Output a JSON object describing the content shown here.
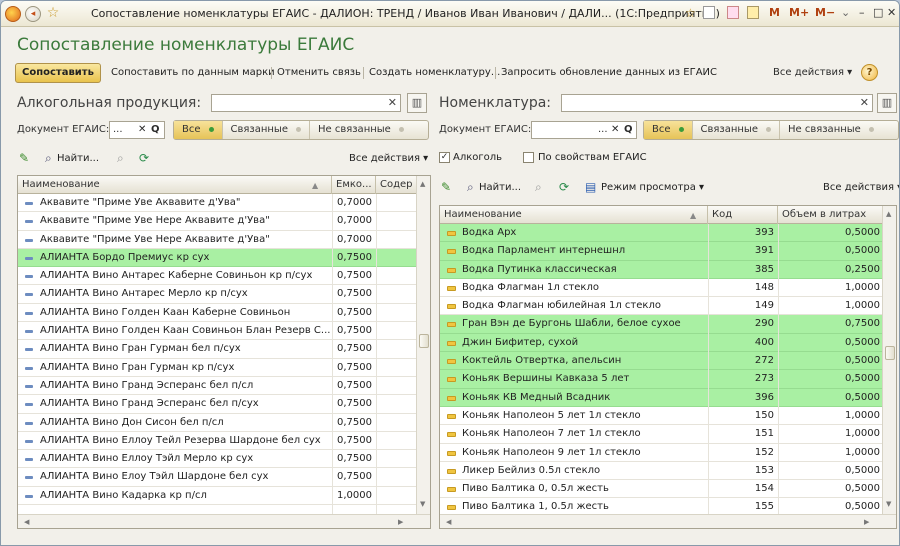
{
  "window": {
    "title": "Сопоставление номенклатуры ЕГАИС - ДАЛИОН: ТРЕНД / Иванов Иван Иванович / ДАЛИ...  (1С:Предприятие)"
  },
  "form": {
    "title": "Сопоставление номенклатуры ЕГАИС"
  },
  "cmdbar": {
    "match_label": "Сопоставить",
    "commands": [
      "Сопоставить по данным марки",
      "Отменить связь",
      "Создать номенклатуру...",
      "Запросить обновление данных из ЕГАИС"
    ],
    "all_actions": "Все действия ▾",
    "help": "?"
  },
  "left": {
    "label": "Алкогольная продукция:",
    "search_value": "",
    "doc_label": "Документ ЕГАИС:",
    "doc_value": "...",
    "filters": [
      "Все",
      "Связанные",
      "Не связанные"
    ],
    "toolbar_find": "Найти...",
    "all_actions": "Все действия ▾",
    "columns": [
      "Наименование",
      "Емко...",
      "Содер"
    ],
    "rows": [
      {
        "name": "Аквавите \"Приме Уве Аквавите д'Ува\"",
        "cap": "0,7000",
        "hl": false
      },
      {
        "name": "Аквавите \"Приме Уве Нере Аквавите д'Ува\"",
        "cap": "0,7000",
        "hl": false
      },
      {
        "name": "Аквавите \"Приме Уве Нере Аквавите д'Ува\"",
        "cap": "0,7000",
        "hl": false
      },
      {
        "name": "АЛИАНТА Бордо Премиус кр сух",
        "cap": "0,7500",
        "hl": true
      },
      {
        "name": "АЛИАНТА Вино Антарес Каберне Совиньон кр п/сух",
        "cap": "0,7500",
        "hl": false
      },
      {
        "name": "АЛИАНТА Вино Антарес Мерло кр п/сух",
        "cap": "0,7500",
        "hl": false
      },
      {
        "name": "АЛИАНТА Вино Голден Каан Каберне Совиньон",
        "cap": "0,7500",
        "hl": false
      },
      {
        "name": "АЛИАНТА Вино Голден Каан Совиньон Блан Резерв С...",
        "cap": "0,7500",
        "hl": false
      },
      {
        "name": "АЛИАНТА Вино Гран Гурман бел п/сух",
        "cap": "0,7500",
        "hl": false
      },
      {
        "name": "АЛИАНТА Вино Гран Гурман кр п/сух",
        "cap": "0,7500",
        "hl": false
      },
      {
        "name": "АЛИАНТА Вино Гранд Эсперанс бел п/сл",
        "cap": "0,7500",
        "hl": false
      },
      {
        "name": "АЛИАНТА Вино Гранд Эсперанс бел п/сух",
        "cap": "0,7500",
        "hl": false
      },
      {
        "name": "АЛИАНТА Вино Дон Сисон бел п/сл",
        "cap": "0,7500",
        "hl": false
      },
      {
        "name": "АЛИАНТА Вино Еллоу Тейл Резерва Шардоне бел сух",
        "cap": "0,7500",
        "hl": false
      },
      {
        "name": "АЛИАНТА Вино Еллоу Тэйл Мерло кр сух",
        "cap": "0,7500",
        "hl": false
      },
      {
        "name": "АЛИАНТА Вино Елоу Тэйл Шардоне бел сух",
        "cap": "0,7500",
        "hl": false
      },
      {
        "name": "АЛИАНТА Вино Кадарка кр п/сл",
        "cap": "1,0000",
        "hl": false
      }
    ]
  },
  "right": {
    "label": "Номенклатура:",
    "search_value": "",
    "doc_label": "Документ ЕГАИС:",
    "doc_value": "...",
    "filters": [
      "Все",
      "Связанные",
      "Не связанные"
    ],
    "chk_alcohol": "Алкоголь",
    "chk_egais": "По свойствам ЕГАИС",
    "toolbar_find": "Найти...",
    "view_mode": "Режим просмотра ▾",
    "all_actions": "Все действия ▾",
    "columns": [
      "Наименование",
      "Код",
      "Объем в литрах"
    ],
    "rows": [
      {
        "name": "Водка Арх",
        "code": "393",
        "vol": "0,5000",
        "hl": true
      },
      {
        "name": "Водка Парламент интернешнл",
        "code": "391",
        "vol": "0,5000",
        "hl": true
      },
      {
        "name": "Водка Путинка классическая",
        "code": "385",
        "vol": "0,2500",
        "hl": true
      },
      {
        "name": "Водка Флагман 1л стекло",
        "code": "148",
        "vol": "1,0000",
        "hl": false
      },
      {
        "name": "Водка Флагман юбилейная 1л стекло",
        "code": "149",
        "vol": "1,0000",
        "hl": false
      },
      {
        "name": "Гран Вэн де Бургонь Шабли, белое сухое",
        "code": "290",
        "vol": "0,7500",
        "hl": true
      },
      {
        "name": "Джин Бифитер, сухой",
        "code": "400",
        "vol": "0,5000",
        "hl": true
      },
      {
        "name": "Коктейль Отвертка, апельсин",
        "code": "272",
        "vol": "0,5000",
        "hl": true
      },
      {
        "name": "Коньяк Вершины Кавказа 5 лет",
        "code": "273",
        "vol": "0,5000",
        "hl": true
      },
      {
        "name": "Коньяк КВ Медный Всадник",
        "code": "396",
        "vol": "0,5000",
        "hl": true
      },
      {
        "name": "Коньяк Наполеон 5 лет 1л стекло",
        "code": "150",
        "vol": "1,0000",
        "hl": false
      },
      {
        "name": "Коньяк Наполеон 7 лет 1л стекло",
        "code": "151",
        "vol": "1,0000",
        "hl": false
      },
      {
        "name": "Коньяк Наполеон 9 лет 1л стекло",
        "code": "152",
        "vol": "1,0000",
        "hl": false
      },
      {
        "name": "Ликер Бейлиз 0.5л стекло",
        "code": "153",
        "vol": "0,5000",
        "hl": false
      },
      {
        "name": "Пиво Балтика 0, 0.5л жесть",
        "code": "154",
        "vol": "0,5000",
        "hl": false
      },
      {
        "name": "Пиво Балтика 1, 0.5л жесть",
        "code": "155",
        "vol": "0,5000",
        "hl": false
      }
    ]
  },
  "colors": {
    "highlight": "#a9f0a3",
    "title_green": "#3b7a3b",
    "button_yellow": "#e9c34d"
  }
}
